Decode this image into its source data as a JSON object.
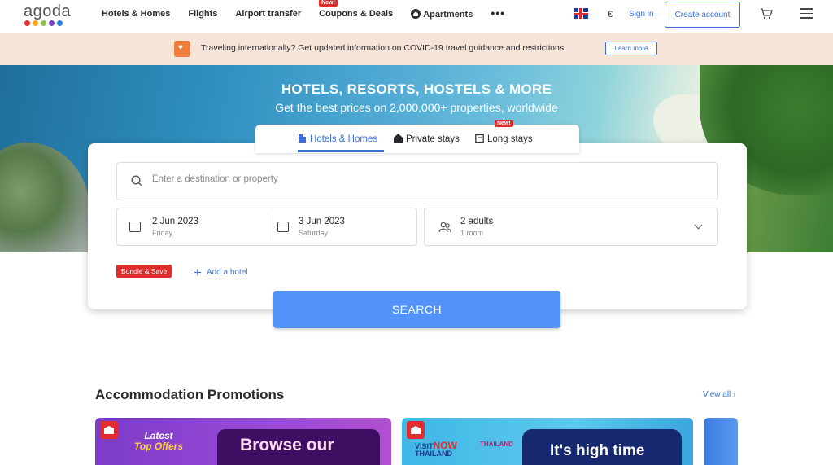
{
  "header": {
    "logo": "agoda",
    "logo_colors": [
      "#e12d2d",
      "#f5a623",
      "#8bc34a",
      "#7b3fc4",
      "#2f7fe0"
    ],
    "nav": [
      {
        "label": "Hotels & Homes",
        "badge": ""
      },
      {
        "label": "Flights",
        "badge": ""
      },
      {
        "label": "Airport transfer",
        "badge": ""
      },
      {
        "label": "Coupons & Deals",
        "badge": "New!"
      },
      {
        "label": "Apartments",
        "badge": ""
      }
    ],
    "more": "•••",
    "currency": "€",
    "sign_in": "Sign in",
    "create_account": "Create account"
  },
  "banner": {
    "text": "Traveling internationally? Get updated information on COVID-19 travel guidance and restrictions.",
    "learn_more": "Learn more"
  },
  "hero": {
    "title": "HOTELS, RESORTS, HOSTELS & MORE",
    "subtitle": "Get the best prices on 2,000,000+ properties, worldwide"
  },
  "tabs": [
    {
      "label": "Hotels & Homes",
      "active": true
    },
    {
      "label": "Private stays",
      "active": false
    },
    {
      "label": "Long stays",
      "active": false,
      "badge": "New!"
    }
  ],
  "search": {
    "destination_placeholder": "Enter a destination or property",
    "checkin": {
      "date": "2 Jun 2023",
      "day": "Friday"
    },
    "checkout": {
      "date": "3 Jun 2023",
      "day": "Saturday"
    },
    "occupancy": {
      "guests": "2 adults",
      "rooms": "1 room"
    },
    "bundle_label": "Bundle & Save",
    "add_hotel": "Add a hotel",
    "search_button": "SEARCH"
  },
  "promotions": {
    "title": "Accommodation Promotions",
    "view_all": "View all ›",
    "cards": [
      {
        "line1": "Latest",
        "line2": "Top Offers",
        "headline": "Browse our"
      },
      {
        "visit": "VISIT",
        "now": "NOW",
        "country": "THAILAND",
        "brand": "THAILAND",
        "headline": "It's high time"
      }
    ]
  }
}
